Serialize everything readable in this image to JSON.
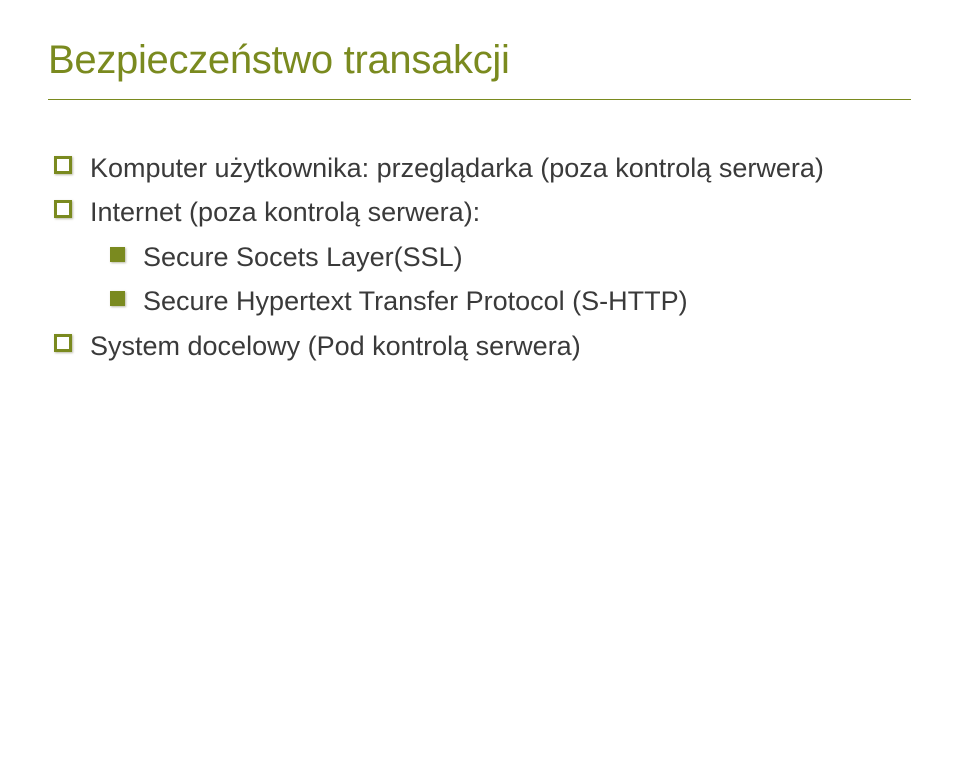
{
  "slide": {
    "title": "Bezpieczeństwo transakcji",
    "items": [
      {
        "level": 1,
        "text": "Komputer użytkownika: przeglądarka (poza kontrolą serwera)"
      },
      {
        "level": 1,
        "text": "Internet (poza kontrolą serwera):"
      },
      {
        "level": 2,
        "text": "Secure Socets Layer(SSL)"
      },
      {
        "level": 2,
        "text": "Secure Hypertext Transfer Protocol (S-HTTP)"
      },
      {
        "level": 1,
        "text": "System docelowy (Pod kontrolą serwera)"
      }
    ]
  }
}
